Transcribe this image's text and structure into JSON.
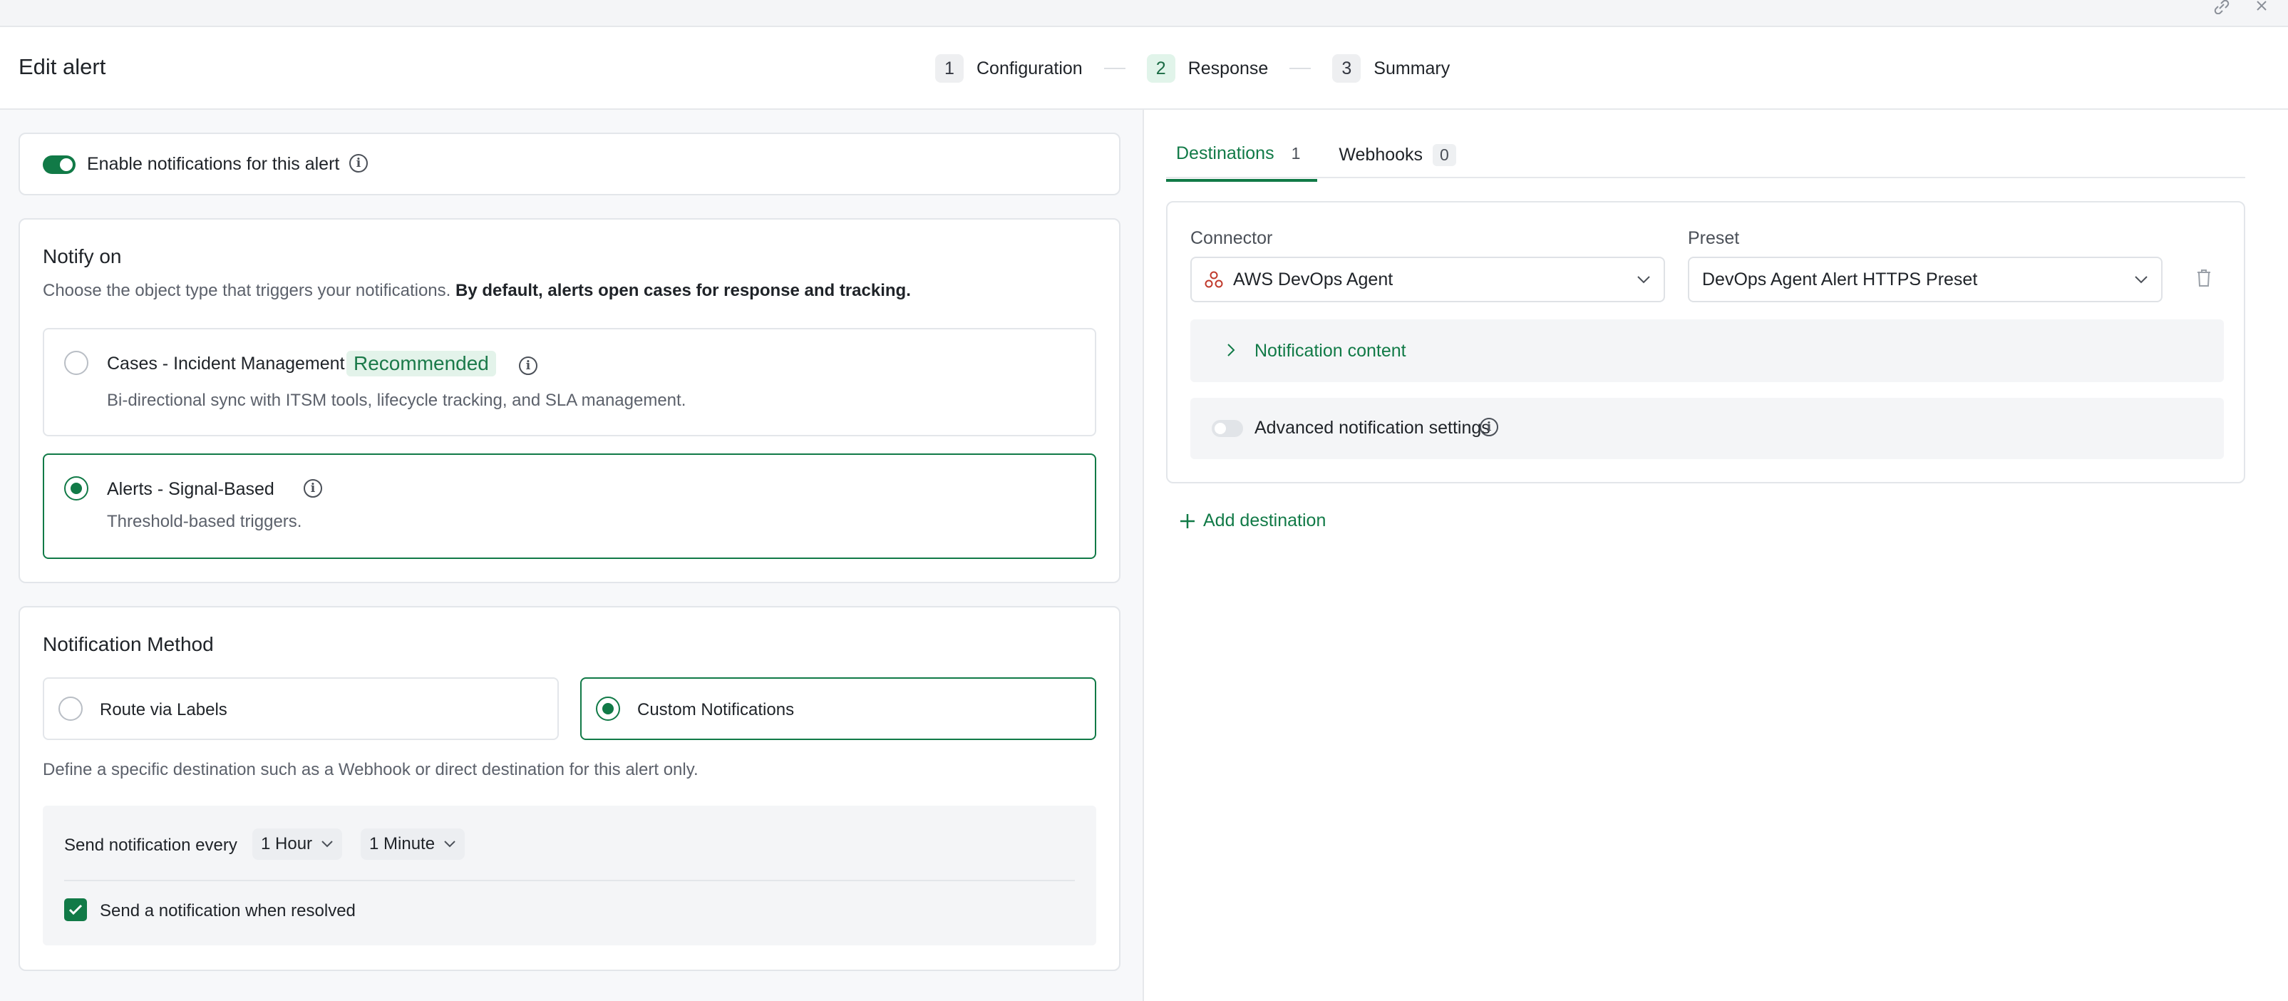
{
  "header": {
    "title": "Edit alert",
    "steps": [
      {
        "num": "1",
        "label": "Configuration",
        "active": false
      },
      {
        "num": "2",
        "label": "Response",
        "active": true
      },
      {
        "num": "3",
        "label": "Summary",
        "active": false
      }
    ],
    "icons": [
      "link-icon",
      "close-icon"
    ]
  },
  "enable": {
    "label": "Enable notifications for this alert",
    "checked": true
  },
  "notify_on": {
    "title": "Notify on",
    "desc": "Choose the object type that triggers your notifications. ",
    "desc_bold": "By default, alerts open cases for response and tracking.",
    "options": [
      {
        "title": "Cases - Incident Management",
        "badge": "Recommended",
        "desc": "Bi-directional sync with ITSM tools, lifecycle tracking, and SLA management.",
        "selected": false
      },
      {
        "title": "Alerts - Signal-Based",
        "desc": "Threshold-based triggers.",
        "selected": true
      }
    ]
  },
  "method": {
    "title": "Notification Method",
    "options": [
      {
        "label": "Route via Labels",
        "selected": false
      },
      {
        "label": "Custom Notifications",
        "selected": true
      }
    ],
    "desc": "Define a specific destination such as a Webhook or direct destination for this alert only.",
    "send_label": "Send notification every",
    "interval_1": "1 Hour",
    "interval_2": "1 Minute",
    "resolved_label": "Send a notification when resolved",
    "resolved_checked": true
  },
  "right": {
    "tabs": [
      {
        "label": "Destinations",
        "count": "1",
        "active": true
      },
      {
        "label": "Webhooks",
        "count": "0",
        "active": false
      }
    ],
    "connector_label": "Connector",
    "connector_value": "AWS DevOps Agent",
    "preset_label": "Preset",
    "preset_value": "DevOps Agent Alert HTTPS Preset",
    "notification_content": "Notification content",
    "advanced_label": "Advanced notification settings",
    "advanced_enabled": false,
    "add_destination": "Add destination"
  },
  "colors": {
    "accent": "#117a47",
    "accent_light": "#e1f4ea"
  }
}
